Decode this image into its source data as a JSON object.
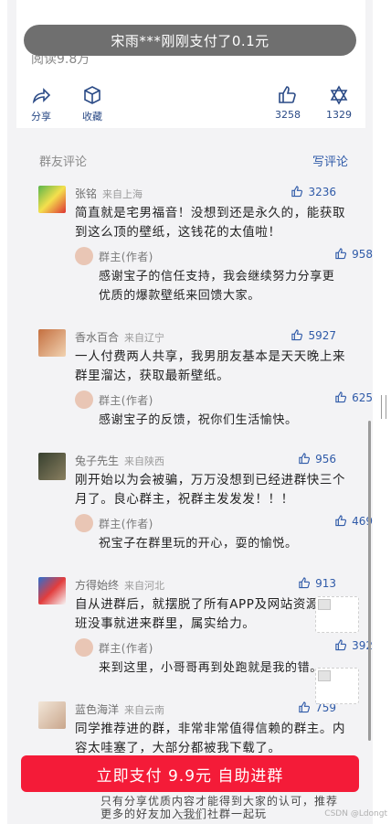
{
  "article": {
    "reads": "阅读9.8万"
  },
  "toast": {
    "text": "宋雨***刚刚支付了0.1元"
  },
  "actions": {
    "share_label": "分享",
    "collect_label": "收藏",
    "like_count": "3258",
    "favor_count": "1329"
  },
  "comments_section": {
    "title": "群友评论",
    "write_label": "写评论"
  },
  "comments": [
    {
      "name": "张铭",
      "location": "来自上海",
      "likes": "3236",
      "text": "简直就是宅男福音！没想到还是永久的，能获取到这么顶的壁纸，这钱花的太值啦！",
      "reply": {
        "name": "群主(作者)",
        "likes": "958",
        "text": "感谢宝子的信任支持，我会继续努力分享更优质的爆款壁纸来回馈大家。"
      }
    },
    {
      "name": "香水百合",
      "location": "来自辽宁",
      "likes": "5927",
      "text": "一人付费两人共享，我男朋友基本是天天晚上来群里溜达，获取最新壁纸。",
      "reply": {
        "name": "群主(作者)",
        "likes": "625",
        "text": "感谢宝子的反馈，祝你们生活愉快。"
      }
    },
    {
      "name": "兔子先生",
      "location": "来自陕西",
      "likes": "956",
      "text": "刚开始以为会被骗，万万没想到已经进群快三个月了。良心群主，祝群主发发发！！！",
      "reply": {
        "name": "群主(作者)",
        "likes": "469",
        "text": "祝宝子在群里玩的开心，耍的愉悦。"
      }
    },
    {
      "name": "方得始终",
      "location": "来自河北",
      "likes": "913",
      "text": "自从进群后，就摆脱了所有APP及网站资源。下班没事就进来群里，属实给力。",
      "reply": {
        "name": "群主(作者)",
        "likes": "392",
        "text": "来到这里，小哥哥再到处跑就是我的错。"
      }
    },
    {
      "name": "蓝色海洋",
      "location": "来自云南",
      "likes": "759",
      "text": "同学推荐进的群，非常非常值得信赖的群主。内容太哇塞了，大部分都被我下载了。"
    }
  ],
  "pay_button": {
    "label": "立即支付 9.9元 自助进群"
  },
  "under_text": "只有分享优质内容才能得到大家的认可，推荐更多的好友加入我们社群一起玩",
  "watermark": "CSDN @Ldongt",
  "colors": {
    "accent_blue": "#2f5aa8",
    "pay_red": "#f41b38",
    "toast_gray": "#6f6f6f"
  }
}
